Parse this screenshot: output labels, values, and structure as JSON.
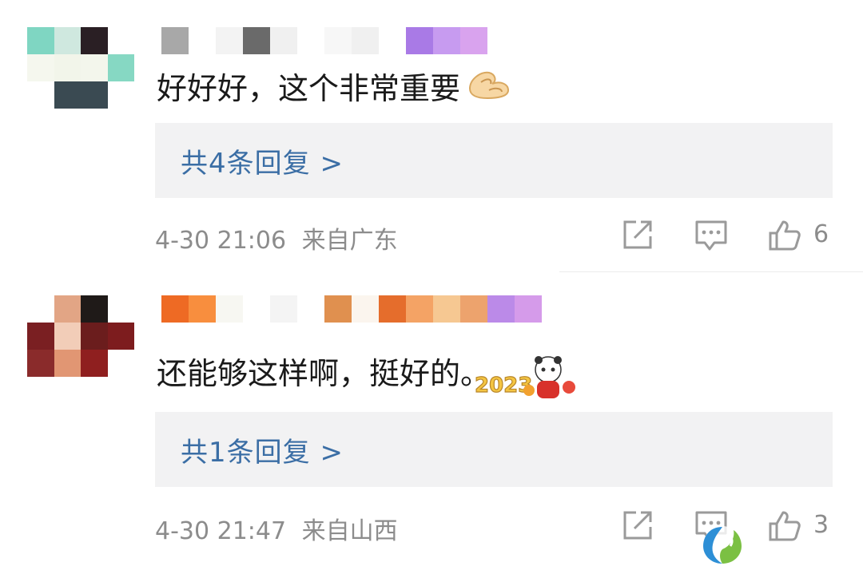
{
  "comments": [
    {
      "content": "好好好，这个非常重要",
      "emoji": "pinching-hand-emoji",
      "reply_label": "共4条回复 >",
      "time": "4-30 21:06",
      "location": "来自广东",
      "like_count": "6",
      "avatar_colors": [
        "#7fd6c2",
        "#cfe8df",
        "#2a1f24",
        "#ffffff",
        "#f5f7ee",
        "#f2f5ea",
        "#f3f6ec",
        "#86d8c3",
        "#ffffff",
        "#3a4a52",
        "#3a4a52",
        "#ffffff"
      ],
      "username_colors": [
        "#a8a8a8",
        "#ffffff",
        "#f3f3f3",
        "#6a6a6a",
        "#f0f0f0",
        "#ffffff",
        "#f7f7f7",
        "#f0f0f0",
        "#ffffff",
        "#a97ae6",
        "#c79bf0",
        "#d9a3ee"
      ]
    },
    {
      "content": "还能够这样啊，挺好的。",
      "emoji": "panda-2023-sticker",
      "reply_label": "共1条回复 >",
      "time": "4-30 21:47",
      "location": "来自山西",
      "like_count": "3",
      "avatar_colors": [
        "#ffffff",
        "#e2a585",
        "#1f1a18",
        "#ffffff",
        "#7a1f22",
        "#f2cdb8",
        "#6b1d1d",
        "#7d1c1e",
        "#8a2b2b",
        "#e19673",
        "#8f1f1f",
        "#ffffff"
      ],
      "username_colors": [
        "#ee6a24",
        "#f88e3e",
        "#f7f7f2",
        "#ffffff",
        "#f4f4f4",
        "#ffffff",
        "#e0904f",
        "#fbf5ee",
        "#e56d2c",
        "#f4a365",
        "#f6c892",
        "#eda36d",
        "#bb8ae8",
        "#d59bea"
      ]
    }
  ],
  "icons": {
    "share": "share-icon",
    "comment": "comment-icon",
    "like": "thumbs-up-icon",
    "watermark": "watermark-logo"
  },
  "colors": {
    "reply_link": "#3b6ea5",
    "meta": "#8c8c8c",
    "reply_bg": "#f2f2f3"
  }
}
